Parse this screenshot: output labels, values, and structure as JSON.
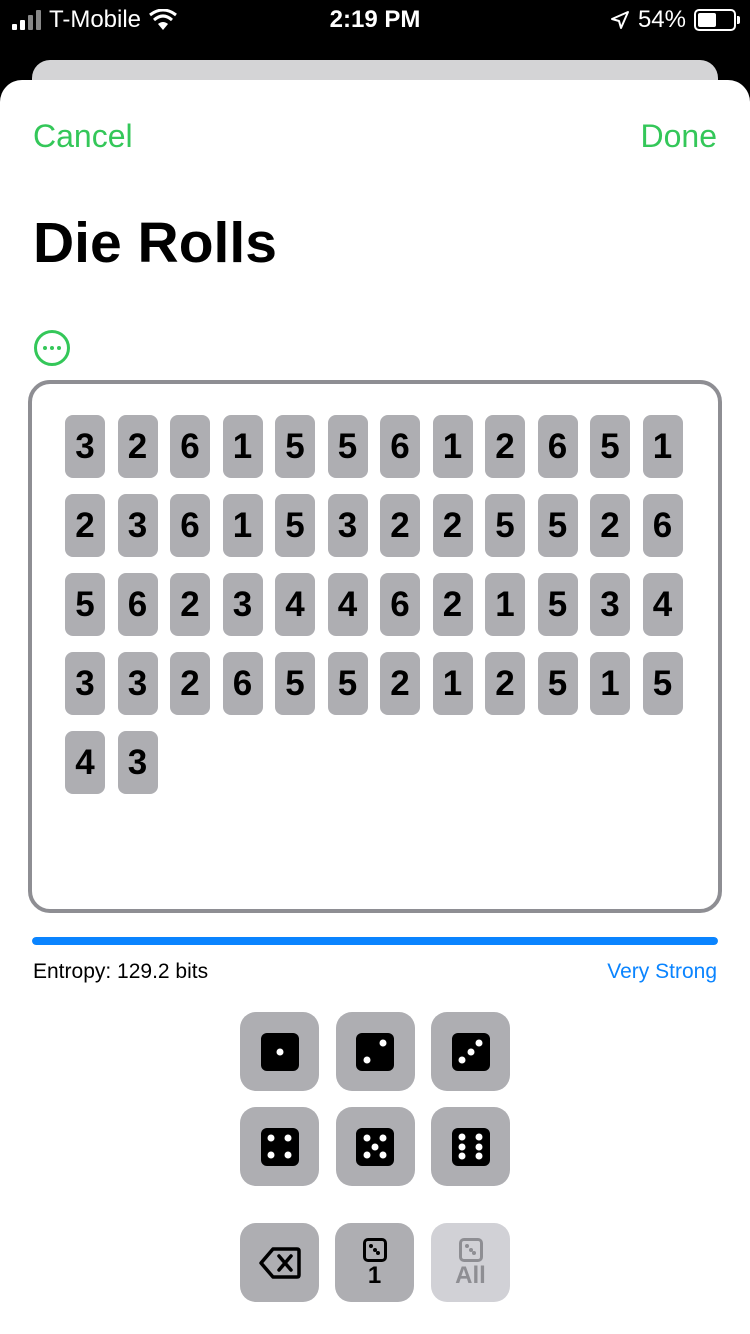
{
  "status_bar": {
    "carrier": "T-Mobile",
    "time": "2:19 PM",
    "battery": "54%",
    "battery_level": 0.54
  },
  "nav": {
    "cancel": "Cancel",
    "done": "Done"
  },
  "title": "Die Rolls",
  "rolls": [
    3,
    2,
    6,
    1,
    5,
    5,
    6,
    1,
    2,
    6,
    5,
    1,
    2,
    3,
    6,
    1,
    5,
    3,
    2,
    2,
    5,
    5,
    2,
    6,
    5,
    6,
    2,
    3,
    4,
    4,
    6,
    2,
    1,
    5,
    3,
    4,
    3,
    3,
    2,
    6,
    5,
    5,
    2,
    1,
    2,
    5,
    1,
    5,
    4,
    3
  ],
  "entropy": {
    "label": "Entropy: 129.2 bits",
    "strength": "Very Strong",
    "level": 1.0
  },
  "keypad": {
    "faces": [
      1,
      2,
      3,
      4,
      5,
      6
    ],
    "count_one": "1",
    "count_all": "All"
  },
  "colors": {
    "accent": "#34c759",
    "blue": "#0a84ff",
    "chip": "#aeaeb2"
  }
}
